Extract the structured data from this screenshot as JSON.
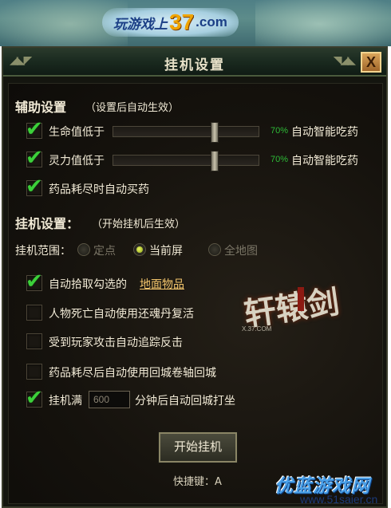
{
  "banner": {
    "logo_prefix": "玩游戏上",
    "logo_number": "37",
    "logo_suffix": ".com"
  },
  "dialog": {
    "title": "挂机设置",
    "close_label": "X"
  },
  "assist": {
    "title": "辅助设置",
    "note": "（设置后自动生效）",
    "hp": {
      "label": "生命值低于",
      "percent": "70%",
      "action": "自动智能吃药",
      "checked": true,
      "level": 0.7
    },
    "mp": {
      "label": "灵力值低于",
      "percent": "70%",
      "action": "自动智能吃药",
      "checked": true,
      "level": 0.7
    },
    "buy_potion": {
      "label": "药品耗尽时自动买药",
      "checked": true
    }
  },
  "hangup": {
    "title": "挂机设置：",
    "note": "（开始挂机后生效）",
    "range_label": "挂机范围：",
    "range_options": [
      "定点",
      "当前屏",
      "全地图"
    ],
    "range_selected": "当前屏",
    "pickup": {
      "label": "自动拾取勾选的",
      "link": "地面物品",
      "checked": true
    },
    "revive": {
      "label": "人物死亡自动使用还魂丹复活",
      "checked": false
    },
    "counter": {
      "label": "受到玩家攻击自动追踪反击",
      "checked": false
    },
    "return_scroll": {
      "label": "药品耗尽后自动使用回城卷轴回城",
      "checked": false
    },
    "timer": {
      "label_prefix": "挂机满",
      "value": "600",
      "label_suffix": "分钟后自动回城打坐",
      "checked": true
    }
  },
  "start_button": "开始挂机",
  "hotkey": "快捷键：A",
  "game_art": {
    "title": "轩辕剑",
    "site": "X.37.COM"
  },
  "site_watermark": {
    "title": "优蓝游戏网",
    "url": "www.51saier.cn"
  },
  "colors": {
    "check": "#3cd03a",
    "percent": "#2dbb37",
    "link": "#f3c56c",
    "text": "#f1ead6"
  }
}
